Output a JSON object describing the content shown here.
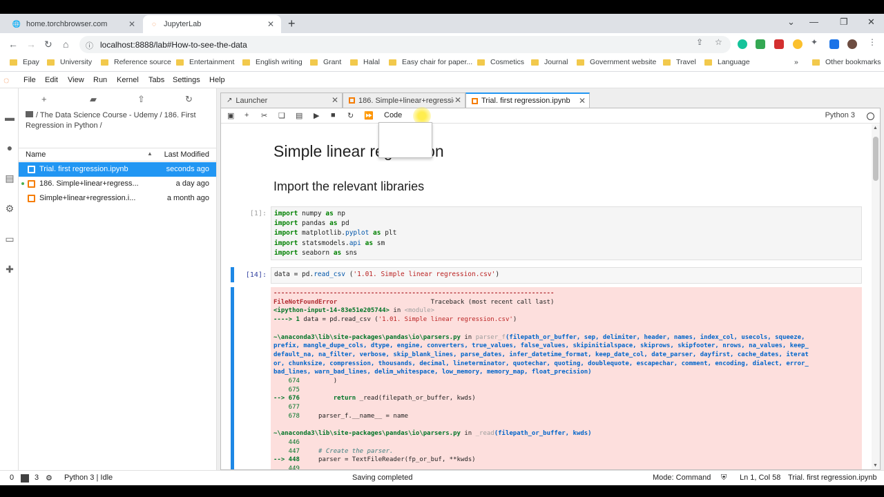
{
  "browser": {
    "tabs": [
      {
        "title": "home.torchbrowser.com",
        "icon": "globe-icon"
      },
      {
        "title": "JupyterLab",
        "icon": "jupyter-icon"
      }
    ],
    "url": "localhost:8888/lab#How-to-see-the-data",
    "bookmarks": [
      "Epay",
      "University",
      "Reference source",
      "Entertainment",
      "English writing",
      "Grant",
      "Halal",
      "Easy chair for paper...",
      "Cosmetics",
      "Journal",
      "Government website",
      "Travel",
      "Language"
    ],
    "more_bookmarks": "»",
    "other_bookmarks": "Other bookmarks"
  },
  "jupyter": {
    "menu": [
      "File",
      "Edit",
      "View",
      "Run",
      "Kernel",
      "Tabs",
      "Settings",
      "Help"
    ],
    "breadcrumb": "/ The Data Science Course - Udemy / 186. First Regression in Python /",
    "file_headers": {
      "name": "Name",
      "modified": "Last Modified"
    },
    "files": [
      {
        "name": "Trial. first regression.ipynb",
        "modified": "seconds ago"
      },
      {
        "name": "186. Simple+linear+regress...",
        "modified": "a day ago"
      },
      {
        "name": "Simple+linear+regression.i...",
        "modified": "a month ago"
      }
    ],
    "doc_tabs": [
      {
        "title": "Launcher"
      },
      {
        "title": "186. Simple+linear+regressic"
      },
      {
        "title": "Trial. first regression.ipynb"
      }
    ],
    "cell_type": "Code",
    "kernel": "Python 3",
    "notebook": {
      "h1": "Simple linear regression",
      "h2": "Import the relevant libraries",
      "cell1_prompt": "[1]:",
      "cell2_prompt": "[14]:"
    },
    "status": {
      "left_a": "0",
      "left_b": "3",
      "kernel_idle": "Python 3 | Idle",
      "saving": "Saving completed",
      "mode": "Mode: Command",
      "position": "Ln 1, Col 58",
      "filename": "Trial. first regression.ipynb"
    }
  },
  "colors": {
    "accent": "#2196f3",
    "jupyter_orange": "#f37626",
    "error_bg": "#fddfdd"
  }
}
